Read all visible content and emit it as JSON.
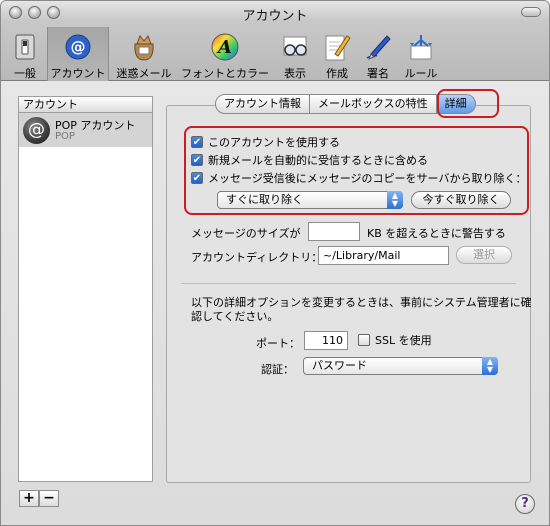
{
  "window": {
    "title": "アカウント"
  },
  "toolbar": {
    "items": [
      {
        "label": "一般",
        "icon": "switch-icon"
      },
      {
        "label": "アカウント",
        "icon": "at-sign-icon",
        "selected": true
      },
      {
        "label": "迷惑メール",
        "icon": "junk-mail-bag-icon"
      },
      {
        "label": "フォントとカラー",
        "icon": "font-color-icon"
      },
      {
        "label": "表示",
        "icon": "glasses-icon"
      },
      {
        "label": "作成",
        "icon": "pencil-paper-icon"
      },
      {
        "label": "署名",
        "icon": "fountain-pen-icon"
      },
      {
        "label": "ルール",
        "icon": "rules-icon"
      }
    ]
  },
  "sidebar": {
    "header": "アカウント",
    "accounts": [
      {
        "name": "POP アカウント",
        "type": "POP"
      }
    ],
    "add_label": "+",
    "remove_label": "−"
  },
  "tabs": [
    {
      "label": "アカウント情報"
    },
    {
      "label": "メールボックスの特性"
    },
    {
      "label": "詳細",
      "active": true
    }
  ],
  "advanced": {
    "enable_account": {
      "label": "このアカウントを使用する",
      "checked": true
    },
    "include_auto_check": {
      "label": "新規メールを自動的に受信するときに含める",
      "checked": true
    },
    "remove_copy": {
      "label": "メッセージ受信後にメッセージのコピーをサーバから取り除く：",
      "checked": true
    },
    "remove_when": "すぐに取り除く",
    "remove_now_button": "今すぐ取り除く",
    "size_warning_prefix": "メッセージのサイズが",
    "size_warning_value": "",
    "size_warning_suffix": "KB を超えるときに警告する",
    "directory_label": "アカウントディレクトリ：",
    "directory_value": "~/Library/Mail",
    "choose_button": "選択",
    "admin_note_line1": "以下の詳細オプションを変更するときは、事前にシステム管理者に確",
    "admin_note_line2": "認してください。",
    "port_label": "ポート：",
    "port_value": "110",
    "ssl_label": "SSL を使用",
    "ssl_checked": false,
    "auth_label": "認証：",
    "auth_value": "パスワード"
  },
  "help": "?"
}
